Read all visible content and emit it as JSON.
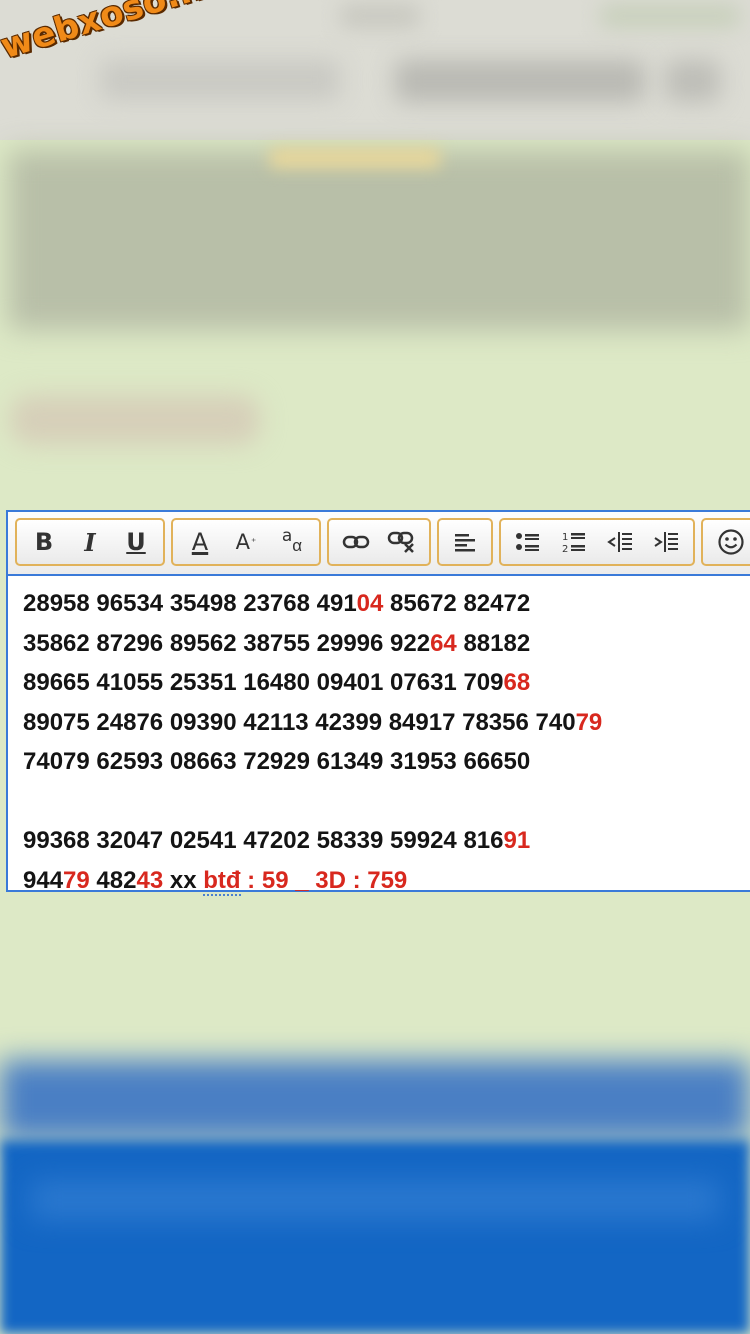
{
  "logo": {
    "text": "webxoso.net"
  },
  "toolbar": {
    "groups": [
      {
        "name": "text-style",
        "buttons": [
          {
            "name": "bold-button",
            "label": "B"
          },
          {
            "name": "italic-button",
            "label": "I"
          },
          {
            "name": "underline-button",
            "label": "U"
          }
        ]
      },
      {
        "name": "font",
        "buttons": [
          {
            "name": "font-color-button",
            "label": "A"
          },
          {
            "name": "font-size-button",
            "label": "A"
          },
          {
            "name": "font-case-button",
            "label": "a"
          }
        ]
      },
      {
        "name": "link",
        "buttons": [
          {
            "name": "insert-link-button",
            "icon": "link-icon"
          },
          {
            "name": "remove-link-button",
            "icon": "unlink-icon"
          }
        ]
      },
      {
        "name": "align",
        "buttons": [
          {
            "name": "align-left-button",
            "icon": "align-left-icon"
          }
        ]
      },
      {
        "name": "list",
        "buttons": [
          {
            "name": "bullet-list-button",
            "icon": "bullet-list-icon"
          },
          {
            "name": "numbered-list-button",
            "icon": "numbered-list-icon"
          },
          {
            "name": "outdent-button",
            "icon": "outdent-icon"
          },
          {
            "name": "indent-button",
            "icon": "indent-icon"
          }
        ]
      },
      {
        "name": "emoji",
        "buttons": [
          {
            "name": "emoji-button",
            "icon": "smiley-icon"
          }
        ]
      }
    ]
  },
  "content": {
    "lines": [
      [
        {
          "t": "28958 96534 35498 23768 491"
        },
        {
          "t": "04",
          "red": true
        },
        {
          "t": " 85672 82472"
        }
      ],
      [
        {
          "t": "35862 87296 89562 38755 29996 922"
        },
        {
          "t": "64",
          "red": true
        },
        {
          "t": " 88182"
        }
      ],
      [
        {
          "t": "89665 41055 25351 16480 09401 07631 709"
        },
        {
          "t": "68",
          "red": true
        }
      ],
      [
        {
          "t": "89075 24876 09390 42113 42399 84917 78356 740"
        },
        {
          "t": "79",
          "red": true
        }
      ],
      [
        {
          "t": "74079 62593 08663 72929 61349 31953 66650"
        }
      ],
      [],
      [
        {
          "t": "99368 32047 02541 47202 58339 59924 816"
        },
        {
          "t": "91",
          "red": true
        }
      ],
      [
        {
          "t": "944"
        },
        {
          "t": "79",
          "red": true
        },
        {
          "t": " 482"
        },
        {
          "t": "43",
          "red": true
        },
        {
          "t": " xx "
        },
        {
          "t": "btđ",
          "red": true,
          "dotted": true
        },
        {
          "t": " : 59 _ 3D : 759",
          "red": true
        }
      ]
    ]
  },
  "colors": {
    "accent_red": "#d8281e",
    "editor_border": "#3a7ad9",
    "button_group_border": "#e1b25a",
    "page_bg": "#dde9c6"
  }
}
